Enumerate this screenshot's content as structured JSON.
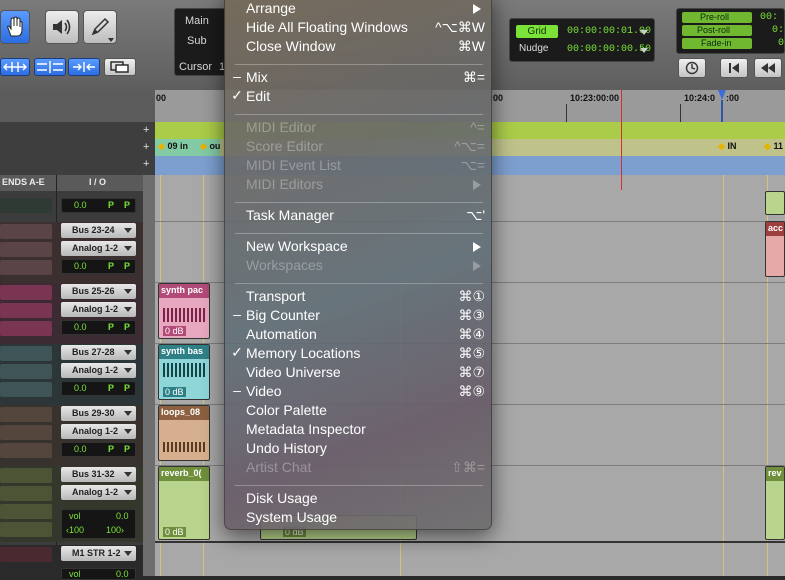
{
  "toolbar": {
    "counter": {
      "main_label": "Main",
      "sub_label": "Sub",
      "cursor_label": "Cursor",
      "cursor_value": "1"
    },
    "grid": {
      "label": "Grid",
      "value": "00:00:00:01.00",
      "nudge_label": "Nudge",
      "nudge_value": "00:00:00:00.50"
    },
    "transport_settings": {
      "preroll_label": "Pre-roll",
      "postroll_label": "Post-roll",
      "fadein_label": "Fade-in",
      "preroll_value": "00:",
      "postroll_value": "0:",
      "fadein_value": "0"
    }
  },
  "rulers": {
    "timecode": [
      "00",
      ":00",
      "10:23:00:00",
      "10:24:0",
      ":00"
    ],
    "markers": [
      "09 in",
      "ou",
      "IN",
      "11"
    ]
  },
  "mixer": {
    "headers": {
      "sends": "ENDS A-E",
      "io": "I / O"
    },
    "tracks": [
      {
        "name": "",
        "bus": "",
        "input": "",
        "vol": "0.0"
      },
      {
        "name": "",
        "bus": "Bus 23-24",
        "input": "Analog 1-2",
        "vol": "0.0"
      },
      {
        "name": "",
        "bus": "Bus 25-26",
        "input": "Analog 1-2",
        "vol": "0.0"
      },
      {
        "name": "",
        "bus": "Bus 27-28",
        "input": "Analog 1-2",
        "vol": "0.0"
      },
      {
        "name": "",
        "bus": "Bus 29-30",
        "input": "Analog 1-2",
        "vol": "0.0"
      },
      {
        "name": "",
        "bus": "Bus 31-32",
        "input": "Analog 1-2",
        "vol_label": "vol",
        "vol": "0.0",
        "pan_l": "‹100",
        "pan_r": "100›"
      },
      {
        "name": "",
        "bus": "M1 STR 1-2",
        "vol_label": "vol",
        "vol": "0.0"
      }
    ],
    "p_label": "P"
  },
  "clips": [
    {
      "name": "synth pac",
      "db": "0 dB"
    },
    {
      "name": "synth bas",
      "db": "0 dB"
    },
    {
      "name": "loops_08",
      "db": "0 dB"
    },
    {
      "name": "reverb_0(",
      "db": "0 dB"
    },
    {
      "name": "acc",
      "db": ""
    },
    {
      "name": "rev",
      "db": "0 dB"
    },
    {
      "name": "",
      "db": "0 dB"
    }
  ],
  "menu": {
    "items": [
      {
        "label": "Arrange",
        "submenu": true,
        "enabled": true
      },
      {
        "label": "Hide All Floating Windows",
        "shortcut": "^⌥⌘W",
        "enabled": true
      },
      {
        "label": "Close Window",
        "shortcut": "⌘W",
        "enabled": true
      },
      {
        "label": "Mix",
        "mark": "–",
        "shortcut": "⌘=",
        "enabled": true
      },
      {
        "label": "Edit",
        "mark": "✓",
        "enabled": true
      },
      {
        "label": "MIDI Editor",
        "shortcut": "^=",
        "enabled": false
      },
      {
        "label": "Score Editor",
        "shortcut": "^⌥=",
        "enabled": false
      },
      {
        "label": "MIDI Event List",
        "shortcut": "⌥=",
        "enabled": false
      },
      {
        "label": "MIDI Editors",
        "submenu": true,
        "enabled": false
      },
      {
        "label": "Task Manager",
        "shortcut": "⌥'",
        "enabled": true
      },
      {
        "label": "New Workspace",
        "submenu": true,
        "enabled": true
      },
      {
        "label": "Workspaces",
        "submenu": true,
        "enabled": false
      },
      {
        "label": "Transport",
        "shortcut": "⌘①",
        "enabled": true
      },
      {
        "label": "Big Counter",
        "mark": "–",
        "shortcut": "⌘③",
        "enabled": true
      },
      {
        "label": "Automation",
        "shortcut": "⌘④",
        "enabled": true
      },
      {
        "label": "Memory Locations",
        "mark": "✓",
        "shortcut": "⌘⑤",
        "enabled": true
      },
      {
        "label": "Video Universe",
        "shortcut": "⌘⑦",
        "enabled": true
      },
      {
        "label": "Video",
        "mark": "–",
        "shortcut": "⌘⑨",
        "enabled": true
      },
      {
        "label": "Color Palette",
        "enabled": true
      },
      {
        "label": "Metadata Inspector",
        "enabled": true
      },
      {
        "label": "Undo History",
        "enabled": true
      },
      {
        "label": "Artist Chat",
        "shortcut": "⇧⌘=",
        "enabled": false
      },
      {
        "label": "Disk Usage",
        "enabled": true
      },
      {
        "label": "System Usage",
        "enabled": true
      }
    ]
  },
  "colors": {
    "accent_green": "#7be338",
    "timeline_bg": "#a8a8a8",
    "selection_blue": "#2c6de0",
    "playhead_red": "#d33030"
  }
}
